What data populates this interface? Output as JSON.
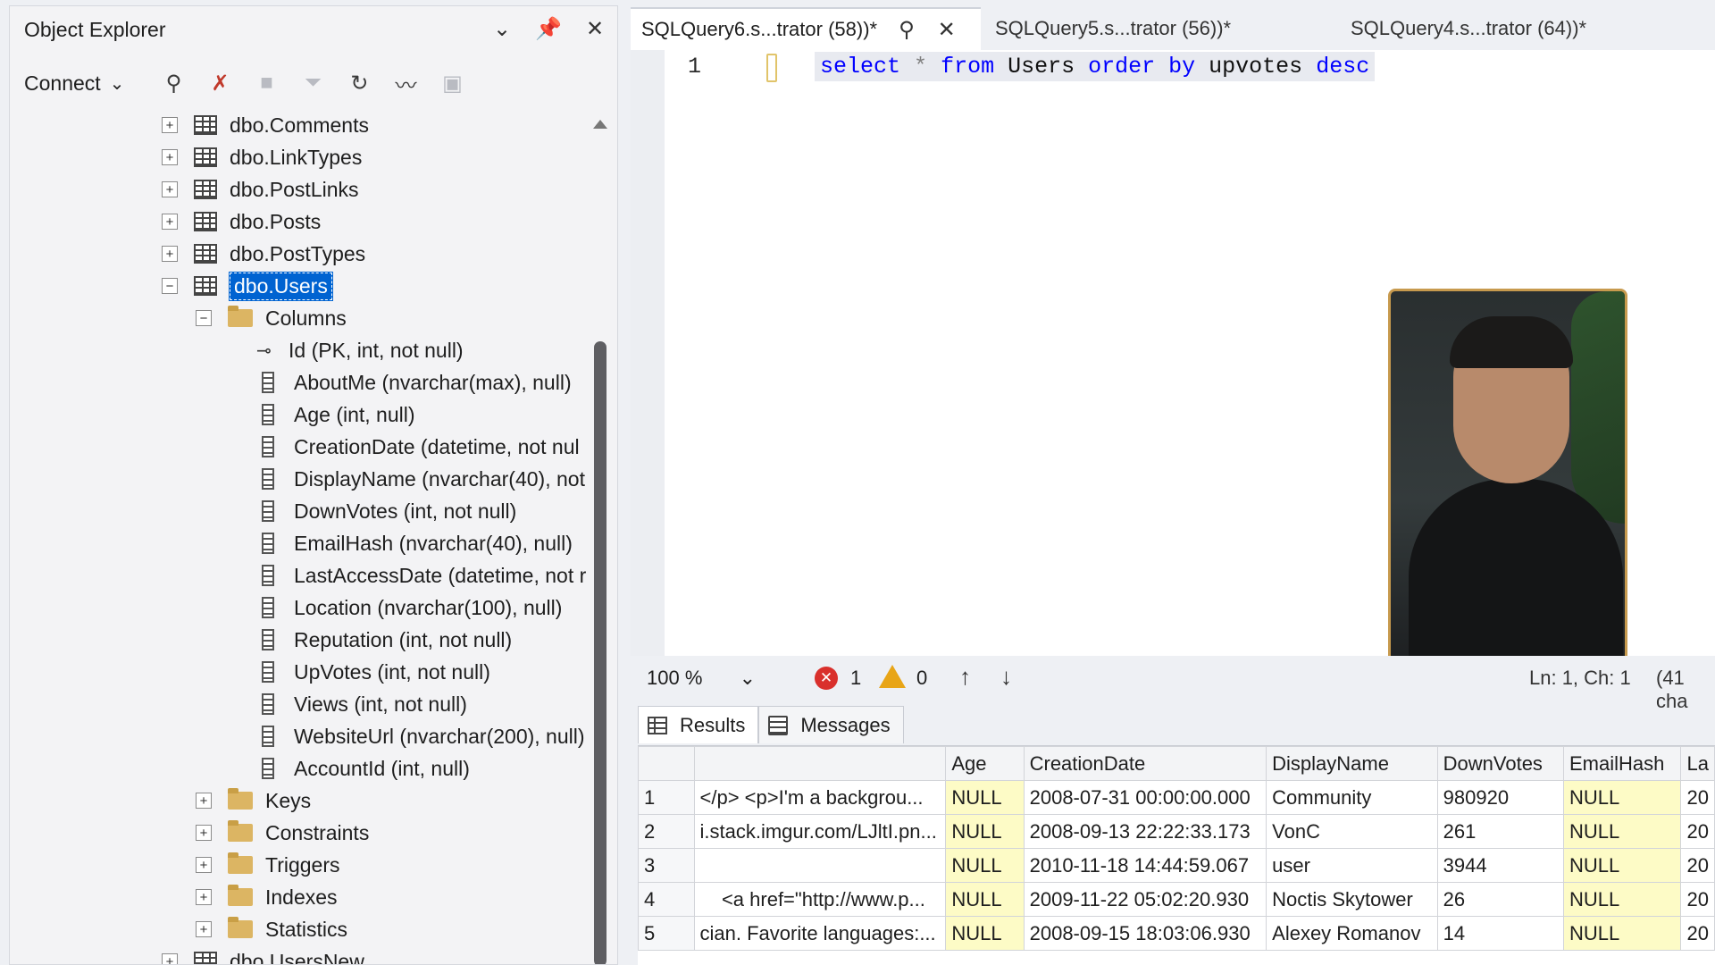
{
  "object_explorer": {
    "title": "Object Explorer",
    "connect_label": "Connect",
    "tree": {
      "tables_before": [
        "dbo.Comments",
        "dbo.LinkTypes",
        "dbo.PostLinks",
        "dbo.Posts",
        "dbo.PostTypes"
      ],
      "selected_table": "dbo.Users",
      "columns_folder": "Columns",
      "columns": [
        "Id (PK, int, not null)",
        "AboutMe (nvarchar(max), null)",
        "Age (int, null)",
        "CreationDate (datetime, not nul",
        "DisplayName (nvarchar(40), not",
        "DownVotes (int, not null)",
        "EmailHash (nvarchar(40), null)",
        "LastAccessDate (datetime, not r",
        "Location (nvarchar(100), null)",
        "Reputation (int, not null)",
        "UpVotes (int, not null)",
        "Views (int, not null)",
        "WebsiteUrl (nvarchar(200), null)",
        "AccountId (int, null)"
      ],
      "folders": [
        "Keys",
        "Constraints",
        "Triggers",
        "Indexes",
        "Statistics"
      ],
      "table_after": "dbo.UsersNew"
    }
  },
  "tabs": [
    {
      "label": "SQLQuery6.s...trator (58))*"
    },
    {
      "label": "SQLQuery5.s...trator (56))*"
    },
    {
      "label": "SQLQuery4.s...trator (64))*"
    }
  ],
  "editor": {
    "line_number": "1",
    "code": {
      "k1": "select",
      "op": "*",
      "k2": "from",
      "t1": "Users",
      "k3": "order by",
      "t2": "upvotes",
      "k4": "desc"
    }
  },
  "status": {
    "zoom": "100 %",
    "errors": "1",
    "warnings": "0",
    "position": "Ln: 1, Ch: 1",
    "chars": "(41 cha"
  },
  "results": {
    "tab_results": "Results",
    "tab_messages": "Messages",
    "columns": [
      "",
      "",
      "Age",
      "CreationDate",
      "DisplayName",
      "DownVotes",
      "EmailHash",
      "La"
    ],
    "rows": [
      [
        "1",
        "</p>  <p>I'm a backgrou...",
        "NULL",
        "2008-07-31 00:00:00.000",
        "Community",
        "980920",
        "NULL",
        "20"
      ],
      [
        "2",
        "i.stack.imgur.com/LJltI.pn...",
        "NULL",
        "2008-09-13 22:22:33.173",
        "VonC",
        "261",
        "NULL",
        "20"
      ],
      [
        "3",
        "",
        "NULL",
        "2010-11-18 14:44:59.067",
        "user",
        "3944",
        "NULL",
        "20"
      ],
      [
        "4",
        "    <a href=\"http://www.p...",
        "NULL",
        "2009-11-22 05:02:20.930",
        "Noctis Skytower",
        "26",
        "NULL",
        "20"
      ],
      [
        "5",
        "cian.  Favorite languages:...",
        "NULL",
        "2008-09-15 18:03:06.930",
        "Alexey Romanov",
        "14",
        "NULL",
        "20"
      ]
    ]
  },
  "colors": {
    "accent": "#0063d1",
    "keyword": "#0000ff",
    "null_cell": "#fdfbc6",
    "error": "#d9302c",
    "warning": "#e8a517"
  }
}
